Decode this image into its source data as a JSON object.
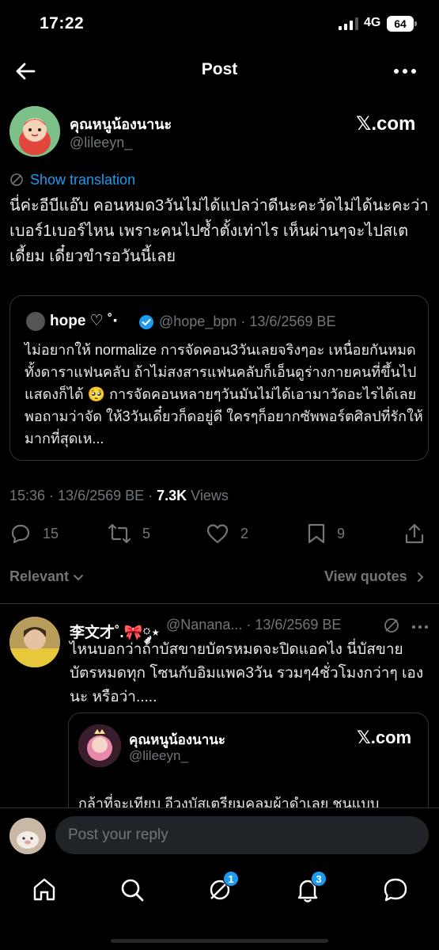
{
  "status_bar": {
    "time": "17:22",
    "network": "4G",
    "battery": "64"
  },
  "header": {
    "title": "Post"
  },
  "tweet": {
    "author_name": "คุณหนูน้องนานะ",
    "author_handle": "@lileeyn_",
    "brand_badge": "𝕏.com",
    "show_translation": "Show translation",
    "body": "นี่ค่ะอีบีแอ๊บ คอนหมด3วันไม่ได้แปลว่าดีนะคะวัดไม่ได้นะคะว่าเบอร์1เบอร์ไหน เพราะคนไปซ้ำตั้งเท่าไร เห็นผ่านๆจะไปสเตเดี้ยม เดี๋ยวขำรอวันนี้เลย",
    "time": "15:36 · 13/6/2569 BE · ",
    "views_count": "7.3K",
    "views_label": " Views",
    "replies": "15",
    "retweets": "5",
    "likes": "2",
    "bookmarks": "9"
  },
  "quote": {
    "name": "hope ♡ ˚‧",
    "meta": "@hope_bpn · 13/6/2569 BE",
    "body": "ไม่อยากให้ normalize การจัดคอน3วันเลยจริงๆอะ เหนื่อยกันหมดทั้งดาราแฟนคลับ ถ้าไม่สงสารแฟนคลับก็เอ็นดูร่างกายคนที่ขึ้นไปแสดงก็ได้ 🥺 การจัดคอนหลายๆวันมันไม่ได้เอามาวัดอะไรได้เลย พอถามว่าจัด ให้3วันเดี๋ยวก็ดอยู่ดี ใครๆก็อยากซัพพอร์ตศิลปที่รักให้มากที่สุดเห..."
  },
  "sort": {
    "relevant": "Relevant",
    "view_quotes": "View quotes"
  },
  "reply": {
    "name": "李文才˚.🎀༘⋆",
    "meta": "@Nanana... · 13/6/2569 BE",
    "body": "ไหนบอกว่าถ้าบัสขายบัตรหมดจะปิดแอคไง นี่บัสขายบัตรหมดทุก โซนกับอิมแพค3วัน รวมๆ4ชั่วโมงกว่าๆ เองนะ หรือว่า.....",
    "embed": {
      "name": "คุณหนูน้องนานะ",
      "handle": "@lileeyn_",
      "brand_badge": "𝕏.com",
      "body": "กล้าที่จะเทียบ อีวงบัสเตรียมคลุมผ้าดำเลย ชนแบบ"
    }
  },
  "composer": {
    "placeholder": "Post your reply"
  },
  "nav": {
    "grok_badge": "1",
    "notifications_badge": "3"
  },
  "colors": {
    "accent": "#1d9bf0",
    "background": "#000000",
    "muted": "#71767b",
    "text": "#e7e9ea",
    "border": "#2f3336"
  }
}
